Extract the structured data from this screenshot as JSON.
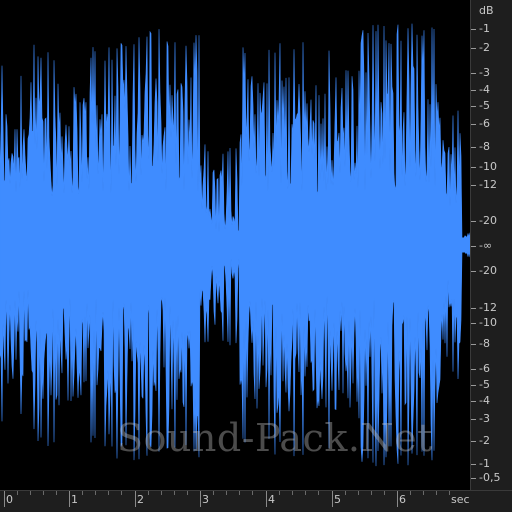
{
  "waveform": {
    "color": "#3f8cff",
    "background": "#000000",
    "watermark": "Sound-Pack.Net"
  },
  "db_ruler": {
    "unit": "dB",
    "upper": [
      "-1",
      "-2",
      "-3",
      "-4",
      "-5",
      "-6",
      "-8",
      "-10",
      "-12",
      "-20"
    ],
    "center": "-∞",
    "lower": [
      "-20",
      "-12",
      "-10",
      "-8",
      "-6",
      "-5",
      "-4",
      "-3",
      "-2",
      "-1",
      "-0,5"
    ]
  },
  "time_ruler": {
    "labels": [
      "0",
      "1",
      "2",
      "3",
      "4",
      "5",
      "6"
    ],
    "unit": "sec"
  }
}
